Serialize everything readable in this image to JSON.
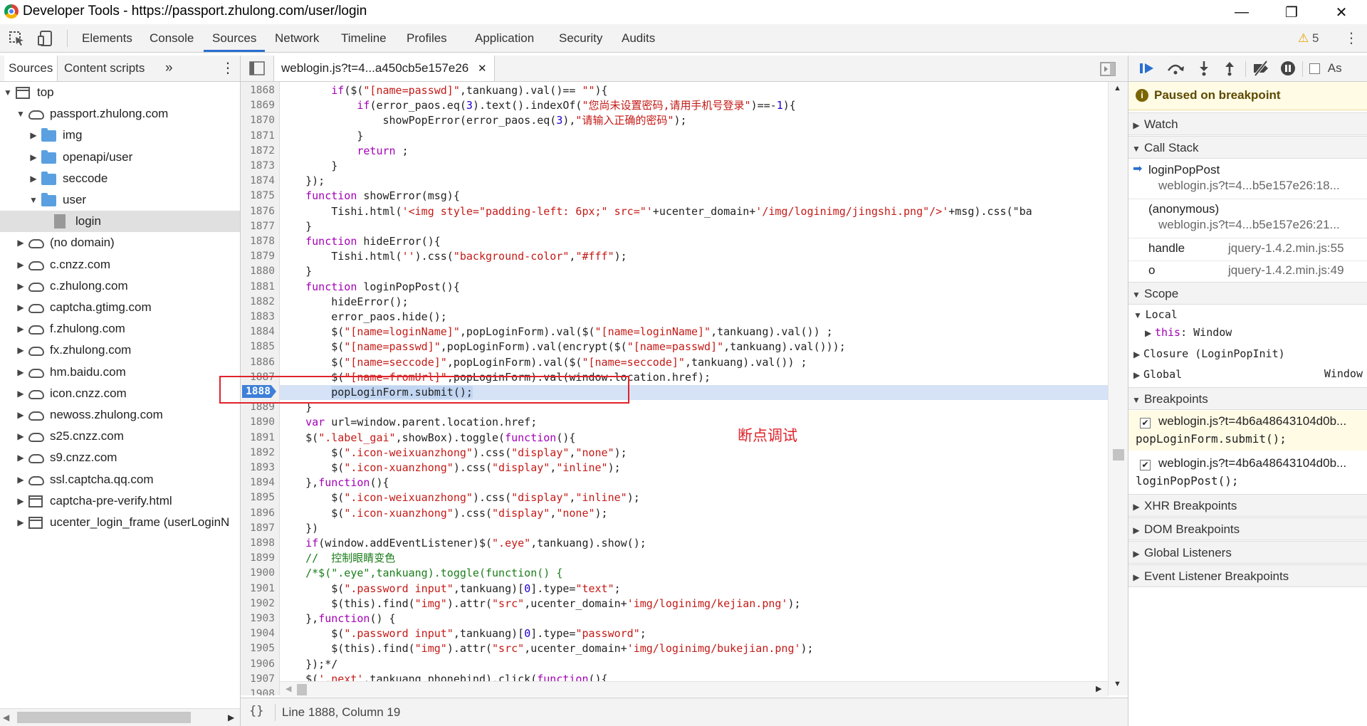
{
  "window": {
    "title": "Developer Tools - https://passport.zhulong.com/user/login",
    "minimize": "—",
    "restore": "❐",
    "close": "✕"
  },
  "main_tabs": [
    "Elements",
    "Console",
    "Sources",
    "Network",
    "Timeline",
    "Profiles",
    "Application",
    "Security",
    "Audits"
  ],
  "active_main_tab": "Sources",
  "warnings": {
    "icon": "warning-icon",
    "count": "5"
  },
  "left_panel": {
    "tabs": [
      "Sources",
      "Content scripts"
    ],
    "more": "»",
    "tree": [
      {
        "label": "top",
        "icon": "frame",
        "level": 0,
        "open": true
      },
      {
        "label": "passport.zhulong.com",
        "icon": "cloud",
        "level": 1,
        "open": true
      },
      {
        "label": "img",
        "icon": "folder",
        "level": 2,
        "open": false
      },
      {
        "label": "openapi/user",
        "icon": "folder",
        "level": 2,
        "open": false
      },
      {
        "label": "seccode",
        "icon": "folder",
        "level": 2,
        "open": false
      },
      {
        "label": "user",
        "icon": "folder",
        "level": 2,
        "open": true
      },
      {
        "label": "login",
        "icon": "file",
        "level": 3,
        "selected": true
      },
      {
        "label": "(no domain)",
        "icon": "cloud",
        "level": 1,
        "open": false
      },
      {
        "label": "c.cnzz.com",
        "icon": "cloud",
        "level": 1,
        "open": false
      },
      {
        "label": "c.zhulong.com",
        "icon": "cloud",
        "level": 1,
        "open": false
      },
      {
        "label": "captcha.gtimg.com",
        "icon": "cloud",
        "level": 1,
        "open": false
      },
      {
        "label": "f.zhulong.com",
        "icon": "cloud",
        "level": 1,
        "open": false
      },
      {
        "label": "fx.zhulong.com",
        "icon": "cloud",
        "level": 1,
        "open": false
      },
      {
        "label": "hm.baidu.com",
        "icon": "cloud",
        "level": 1,
        "open": false
      },
      {
        "label": "icon.cnzz.com",
        "icon": "cloud",
        "level": 1,
        "open": false
      },
      {
        "label": "newoss.zhulong.com",
        "icon": "cloud",
        "level": 1,
        "open": false
      },
      {
        "label": "s25.cnzz.com",
        "icon": "cloud",
        "level": 1,
        "open": false
      },
      {
        "label": "s9.cnzz.com",
        "icon": "cloud",
        "level": 1,
        "open": false
      },
      {
        "label": "ssl.captcha.qq.com",
        "icon": "cloud",
        "level": 1,
        "open": false
      },
      {
        "label": "captcha-pre-verify.html",
        "icon": "frame",
        "level": 1,
        "open": false
      },
      {
        "label": "ucenter_login_frame (userLoginN",
        "icon": "frame",
        "level": 1,
        "open": false
      }
    ]
  },
  "editor": {
    "file_tab": "weblogin.js?t=4...a450cb5e157e26",
    "current_line": 1888,
    "annotation": "断点调试",
    "status": "Line 1888, Column 19",
    "format_icon": "{}",
    "lines": [
      {
        "n": 1868,
        "t": "        if($(\"[name=passwd]\",tankuang).val()== \"\"){"
      },
      {
        "n": 1869,
        "t": "            if(error_paos.eq(3).text().indexOf(\"您尚未设置密码,请用手机号登录\")==-1){"
      },
      {
        "n": 1870,
        "t": "                showPopError(error_paos.eq(3),\"请输入正确的密码\");"
      },
      {
        "n": 1871,
        "t": "            }"
      },
      {
        "n": 1872,
        "t": "            return ;"
      },
      {
        "n": 1873,
        "t": "        }"
      },
      {
        "n": 1874,
        "t": "    });"
      },
      {
        "n": 1875,
        "t": "    function showError(msg){"
      },
      {
        "n": 1876,
        "t": "        Tishi.html('<img style=\"padding-left: 6px;\" src=\"'+ucenter_domain+'/img/loginimg/jingshi.png\"/>'+msg).css(\"ba"
      },
      {
        "n": 1877,
        "t": "    }"
      },
      {
        "n": 1878,
        "t": "    function hideError(){"
      },
      {
        "n": 1879,
        "t": "        Tishi.html('').css(\"background-color\",\"#fff\");"
      },
      {
        "n": 1880,
        "t": "    }"
      },
      {
        "n": 1881,
        "t": "    function loginPopPost(){"
      },
      {
        "n": 1882,
        "t": "        hideError();"
      },
      {
        "n": 1883,
        "t": "        error_paos.hide();"
      },
      {
        "n": 1884,
        "t": "        $(\"[name=loginName]\",popLoginForm).val($(\"[name=loginName]\",tankuang).val()) ;"
      },
      {
        "n": 1885,
        "t": "        $(\"[name=passwd]\",popLoginForm).val(encrypt($(\"[name=passwd]\",tankuang).val()));"
      },
      {
        "n": 1886,
        "t": "        $(\"[name=seccode]\",popLoginForm).val($(\"[name=seccode]\",tankuang).val()) ;"
      },
      {
        "n": 1887,
        "t": "        $(\"[name=fromUrl]\",popLoginForm).val(window.location.href);"
      },
      {
        "n": 1888,
        "t": "        popLoginForm.submit();"
      },
      {
        "n": 1889,
        "t": "    }"
      },
      {
        "n": 1890,
        "t": "    var url=window.parent.location.href;"
      },
      {
        "n": 1891,
        "t": "    $(\".label_gai\",showBox).toggle(function(){"
      },
      {
        "n": 1892,
        "t": "        $(\".icon-weixuanzhong\").css(\"display\",\"none\");"
      },
      {
        "n": 1893,
        "t": "        $(\".icon-xuanzhong\").css(\"display\",\"inline\");"
      },
      {
        "n": 1894,
        "t": "    },function(){"
      },
      {
        "n": 1895,
        "t": "        $(\".icon-weixuanzhong\").css(\"display\",\"inline\");"
      },
      {
        "n": 1896,
        "t": "        $(\".icon-xuanzhong\").css(\"display\",\"none\");"
      },
      {
        "n": 1897,
        "t": "    })"
      },
      {
        "n": 1898,
        "t": "    if(window.addEventListener)$(\".eye\",tankuang).show();"
      },
      {
        "n": 1899,
        "t": "    //  控制眼睛变色"
      },
      {
        "n": 1900,
        "t": "    /*$(\".eye\",tankuang).toggle(function() {"
      },
      {
        "n": 1901,
        "t": "        $(\".password input\",tankuang)[0].type=\"text\";"
      },
      {
        "n": 1902,
        "t": "        $(this).find(\"img\").attr(\"src\",ucenter_domain+'img/loginimg/kejian.png');"
      },
      {
        "n": 1903,
        "t": "    },function() {"
      },
      {
        "n": 1904,
        "t": "        $(\".password input\",tankuang)[0].type=\"password\";"
      },
      {
        "n": 1905,
        "t": "        $(this).find(\"img\").attr(\"src\",ucenter_domain+'img/loginimg/bukejian.png');"
      },
      {
        "n": 1906,
        "t": "    });*/"
      },
      {
        "n": 1907,
        "t": "    $('.next',tankuang_phonebind).click(function(){"
      },
      {
        "n": 1908,
        "t": ""
      }
    ]
  },
  "debugger": {
    "paused_message": "Paused on breakpoint",
    "async_label": "As",
    "watch": "Watch",
    "call_stack": {
      "title": "Call Stack",
      "frames": [
        {
          "name": "loginPopPost",
          "location": "weblogin.js?t=4...b5e157e26:18...",
          "current": true
        },
        {
          "name": "(anonymous)",
          "location": "weblogin.js?t=4...b5e157e26:21..."
        },
        {
          "name": "handle",
          "location": "jquery-1.4.2.min.js:55"
        },
        {
          "name": "o",
          "location": "jquery-1.4.2.min.js:49"
        }
      ]
    },
    "scope": {
      "title": "Scope",
      "local": "Local",
      "this_key": "this",
      "this_value": ": Window",
      "closure": "Closure (LoginPopInit)",
      "global": "Global",
      "global_value": "Window"
    },
    "breakpoints": {
      "title": "Breakpoints",
      "items": [
        {
          "file": "weblogin.js?t=4b6a48643104d0b...",
          "code": "popLoginForm.submit();",
          "active": true
        },
        {
          "file": "weblogin.js?t=4b6a48643104d0b...",
          "code": "loginPopPost();",
          "active": false
        }
      ]
    },
    "more_sections": [
      "XHR Breakpoints",
      "DOM Breakpoints",
      "Global Listeners",
      "Event Listener Breakpoints"
    ]
  }
}
